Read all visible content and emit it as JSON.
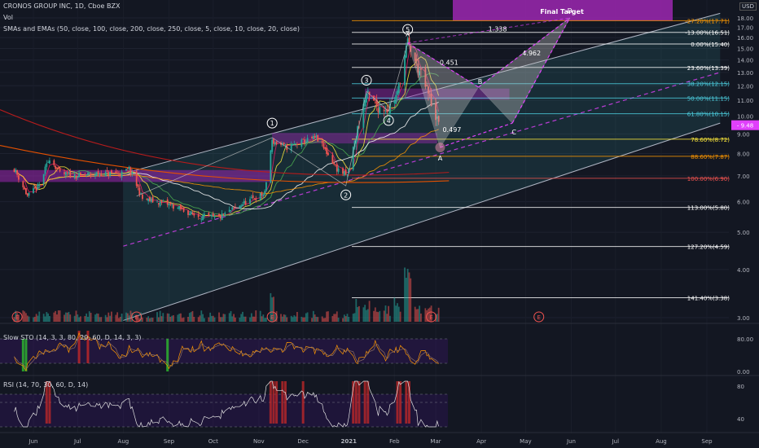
{
  "header": {
    "symbol_line": "CRONOS GROUP INC, 1D, Cboe BZX",
    "vol_label": "Vol",
    "ma_line": "SMAs and EMAs (50, close, 100, close, 200, close, 250, close, 5, close, 10, close, 20, close)",
    "currency": "USD"
  },
  "colors": {
    "background": "#131722",
    "up": "#26a69a",
    "down": "#ef5350",
    "channel": "#aeb4c2",
    "fill": "#2e7d80",
    "purple": "#9c27b0",
    "magenta": "#e040fb",
    "cyan": "#4dd0e1",
    "pattern": "#c9c9c9",
    "sto_green": "#2ebd2e",
    "sto_red": "#c62828"
  },
  "chart_data": [
    {
      "type": "candlestick",
      "title": "CRONOS GROUP INC, 1D, Cboe BZX",
      "yaxis": {
        "scale": "log",
        "range": [
          2.8,
          18.6
        ],
        "ticks": [
          3.0,
          4.0,
          5.0,
          6.0,
          7.0,
          8.0,
          9.0,
          10.0,
          11.0,
          12.0,
          13.0,
          14.0,
          15.0,
          16.0,
          17.0,
          18.0
        ],
        "tick_labels": [
          "3.00",
          "4.00",
          "5.00",
          "6.00",
          "7.00",
          "8.00",
          "9.00",
          "10.00",
          "11.00",
          "12.00",
          "13.00",
          "14.00",
          "15.00",
          "16.00",
          "17.00",
          "18.00"
        ]
      },
      "xaxis": {
        "range": [
          "2020-05-19",
          "2021-09-30"
        ],
        "ticks": [
          "2020-06-01",
          "2020-07-01",
          "2020-08-01",
          "2020-09-01",
          "2020-10-01",
          "2020-11-01",
          "2020-12-01",
          "2021-01-01",
          "2021-02-01",
          "2021-03-01",
          "2021-04-01",
          "2021-05-01",
          "2021-06-01",
          "2021-07-01",
          "2021-08-01",
          "2021-09-01"
        ],
        "tick_labels": [
          "Jun",
          "Jul",
          "Aug",
          "Sep",
          "Oct",
          "Nov",
          "Dec",
          "2021",
          "Feb",
          "Mar",
          "Apr",
          "May",
          "Jun",
          "Jul",
          "Aug",
          "Sep"
        ]
      },
      "price_anchors": [
        [
          "2020-05-19",
          7.3
        ],
        [
          "2020-05-28",
          6.2
        ],
        [
          "2020-06-05",
          6.6
        ],
        [
          "2020-06-12",
          7.8
        ],
        [
          "2020-06-19",
          7.1
        ],
        [
          "2020-06-30",
          7.0
        ],
        [
          "2020-07-15",
          7.1
        ],
        [
          "2020-07-31",
          7.1
        ],
        [
          "2020-08-05",
          7.3
        ],
        [
          "2020-08-14",
          6.1
        ],
        [
          "2020-09-01",
          5.9
        ],
        [
          "2020-09-20",
          5.5
        ],
        [
          "2020-10-05",
          5.45
        ],
        [
          "2020-10-20",
          5.9
        ],
        [
          "2020-11-05",
          6.3
        ],
        [
          "2020-11-10",
          8.6
        ],
        [
          "2020-11-20",
          8.3
        ],
        [
          "2020-12-01",
          8.6
        ],
        [
          "2020-12-10",
          8.8
        ],
        [
          "2020-12-24",
          7.3
        ],
        [
          "2020-12-31",
          7.0
        ],
        [
          "2021-01-06",
          8.9
        ],
        [
          "2021-01-13",
          11.4
        ],
        [
          "2021-01-20",
          10.6
        ],
        [
          "2021-01-28",
          10.5
        ],
        [
          "2021-02-03",
          11.4
        ],
        [
          "2021-02-10",
          15.5
        ],
        [
          "2021-02-16",
          13.6
        ],
        [
          "2021-02-24",
          11.4
        ],
        [
          "2021-03-03",
          9.48
        ]
      ],
      "last_price_label": "9.48",
      "fib_levels": [
        {
          "ratio_label": "-27.20%",
          "price": 17.71,
          "label": "-27.20%(17.71)",
          "color": "#ff9800"
        },
        {
          "ratio_label": "-13.00%",
          "price": 16.51,
          "label": "-13.00%(16.51)",
          "color": "#ffffff"
        },
        {
          "ratio_label": "0.00%",
          "price": 15.4,
          "label": "0.00%(15.40)",
          "color": "#ffffff"
        },
        {
          "ratio_label": "23.60%",
          "price": 13.39,
          "label": "23.60%(13.39)",
          "color": "#ffffff"
        },
        {
          "ratio_label": "38.20%",
          "price": 12.15,
          "label": "38.20%(12.15)",
          "color": "#4dd0e1"
        },
        {
          "ratio_label": "50.00%",
          "price": 11.15,
          "label": "50.00%(11.15)",
          "color": "#4dd0e1"
        },
        {
          "ratio_label": "61.80%",
          "price": 10.15,
          "label": "61.80%(10.15)",
          "color": "#4dd0e1"
        },
        {
          "ratio_label": "78.60%",
          "price": 8.72,
          "label": "78.60%(8.72)",
          "color": "#ffeb3b"
        },
        {
          "ratio_label": "88.60%",
          "price": 7.87,
          "label": "88.60%(7.87)",
          "color": "#ff9800"
        },
        {
          "ratio_label": "100.00%",
          "price": 6.9,
          "label": "100.00%(6.90)",
          "color": "#ef5350"
        },
        {
          "ratio_label": "113.00%",
          "price": 5.8,
          "label": "113.00%(5.80)",
          "color": "#ffffff"
        },
        {
          "ratio_label": "127.20%",
          "price": 4.59,
          "label": "127.20%(4.59)",
          "color": "#ffffff"
        },
        {
          "ratio_label": "141.40%",
          "price": 3.38,
          "label": "141.40%(3.38)",
          "color": "#ffffff"
        }
      ],
      "wave_labels": [
        {
          "label": "1",
          "date": "2020-11-10",
          "price": 9.6
        },
        {
          "label": "2",
          "date": "2020-12-30",
          "price": 6.25
        },
        {
          "label": "3",
          "date": "2021-01-13",
          "price": 12.4
        },
        {
          "label": "4",
          "date": "2021-01-28",
          "price": 9.75
        },
        {
          "label": "5",
          "date": "2021-02-10",
          "price": 16.8
        }
      ],
      "harmonic_points": [
        {
          "label": "X",
          "date": "2021-02-10",
          "price": 15.5
        },
        {
          "label": "A",
          "date": "2021-03-04",
          "price": 8.3
        },
        {
          "label": "B",
          "date": "2021-03-30",
          "price": 11.9
        },
        {
          "label": "C",
          "date": "2021-04-22",
          "price": 9.6
        },
        {
          "label": "D",
          "date": "2021-05-31",
          "price": 18.0
        }
      ],
      "ratio_labels": [
        {
          "text": "0.451",
          "date": "2021-03-10",
          "price": 13.6
        },
        {
          "text": "0.497",
          "date": "2021-03-12",
          "price": 9.1
        },
        {
          "text": "4.962",
          "date": "2021-05-05",
          "price": 14.4
        },
        {
          "text": "1.338",
          "date": "2021-04-12",
          "price": 16.6
        }
      ],
      "target_label": "Final Target",
      "earnings_markers": [
        {
          "label": "E",
          "date": "2020-05-21"
        },
        {
          "label": "E",
          "date": "2020-08-10"
        },
        {
          "label": "E",
          "date": "2020-11-10"
        },
        {
          "label": "E",
          "date": "2021-02-26"
        },
        {
          "label": "E",
          "date": "2021-05-10"
        }
      ],
      "moving_average_levels_at_last": [
        8.7,
        7.2,
        6.9,
        6.6
      ]
    },
    {
      "type": "line",
      "title": "Slow STO (14, 3, 3, 80, 20, 60, D, 14, 3, 3)",
      "yaxis": {
        "ticks": [
          0.0,
          80.0
        ],
        "tick_labels": [
          "0.00",
          "80.00"
        ],
        "range": [
          -8,
          100
        ]
      },
      "overbought": 80,
      "oversold": 20
    },
    {
      "type": "line",
      "title": "RSI (14, 70, 30, 60, D, 14)",
      "yaxis": {
        "ticks": [
          40,
          80
        ],
        "tick_labels": [
          "40",
          "80"
        ],
        "range": [
          28,
          90
        ]
      },
      "upper": 70,
      "lower": 30
    }
  ]
}
